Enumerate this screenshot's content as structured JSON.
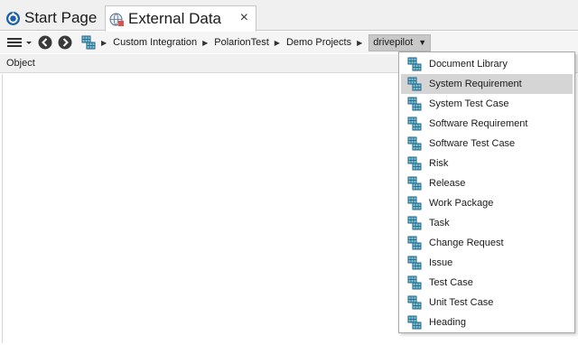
{
  "tabs": [
    {
      "label": "Start Page",
      "icon": "start-page-icon"
    },
    {
      "label": "External Data",
      "icon": "external-data-icon",
      "active": true,
      "close": "×"
    }
  ],
  "breadcrumb": {
    "items": [
      "Custom Integration",
      "PolarionTest",
      "Demo Projects"
    ],
    "current": "drivepilot",
    "separator": "▶",
    "dropdown_glyph": "▼"
  },
  "grid": {
    "columns": [
      "Object"
    ]
  },
  "dropdown": {
    "selected_index": 1,
    "items": [
      "Document Library",
      "System Requirement",
      "System Test Case",
      "Software Requirement",
      "Software Test Case",
      "Risk",
      "Release",
      "Work Package",
      "Task",
      "Change Request",
      "Issue",
      "Test Case",
      "Unit Test Case",
      "Heading"
    ]
  },
  "colors": {
    "accent_blue": "#1f5fa8",
    "teal": "#2a9aa8",
    "selection": "#d5d5d5"
  }
}
